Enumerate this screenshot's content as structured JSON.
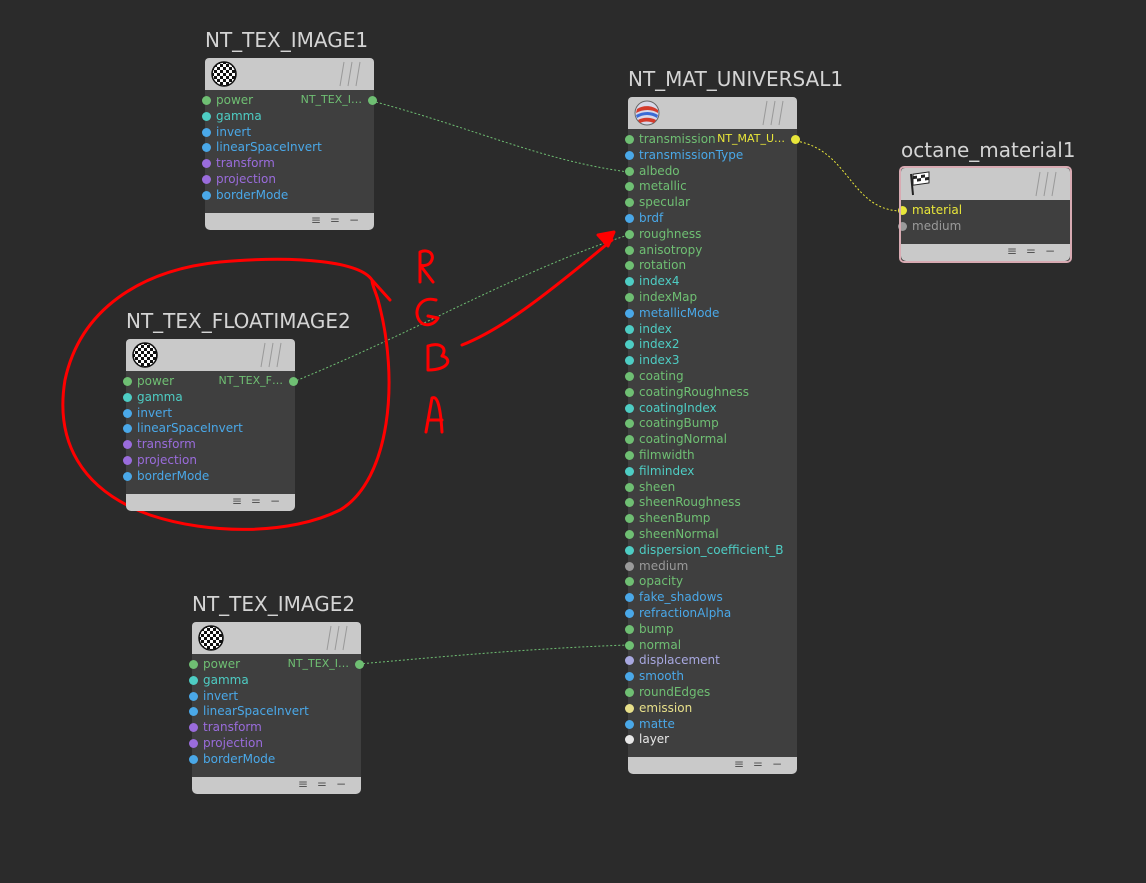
{
  "colors": {
    "background": "#2b2b2b",
    "green": "#6fbf73",
    "cyan": "#4ecdc4",
    "blue": "#4aa8e8",
    "purple": "#9a6cdc",
    "yellow": "#e8e63a",
    "gray": "#9a9a9a",
    "white": "#e8e8e8",
    "lavender": "#a8a8e0",
    "paleyellow": "#e8e08a",
    "annotation_red": "#ff0000"
  },
  "nodes": {
    "tex_image1": {
      "title": "NT_TEX_IMAGE1",
      "icon": "checker-sphere-icon",
      "output_label": "NT_TEX_I…",
      "inputs": [
        {
          "label": "power",
          "color": "green"
        },
        {
          "label": "gamma",
          "color": "cyan"
        },
        {
          "label": "invert",
          "color": "blue"
        },
        {
          "label": "linearSpaceInvert",
          "color": "blue"
        },
        {
          "label": "transform",
          "color": "purple"
        },
        {
          "label": "projection",
          "color": "purple"
        },
        {
          "label": "borderMode",
          "color": "blue"
        }
      ]
    },
    "tex_floatimage2": {
      "title": "NT_TEX_FLOATIMAGE2",
      "icon": "checker-sphere-icon",
      "output_label": "NT_TEX_F…",
      "inputs": [
        {
          "label": "power",
          "color": "green"
        },
        {
          "label": "gamma",
          "color": "cyan"
        },
        {
          "label": "invert",
          "color": "blue"
        },
        {
          "label": "linearSpaceInvert",
          "color": "blue"
        },
        {
          "label": "transform",
          "color": "purple"
        },
        {
          "label": "projection",
          "color": "purple"
        },
        {
          "label": "borderMode",
          "color": "blue"
        }
      ]
    },
    "tex_image2": {
      "title": "NT_TEX_IMAGE2",
      "icon": "checker-sphere-icon",
      "output_label": "NT_TEX_I…",
      "inputs": [
        {
          "label": "power",
          "color": "green"
        },
        {
          "label": "gamma",
          "color": "cyan"
        },
        {
          "label": "invert",
          "color": "blue"
        },
        {
          "label": "linearSpaceInvert",
          "color": "blue"
        },
        {
          "label": "transform",
          "color": "purple"
        },
        {
          "label": "projection",
          "color": "purple"
        },
        {
          "label": "borderMode",
          "color": "blue"
        }
      ]
    },
    "mat_universal1": {
      "title": "NT_MAT_UNIVERSAL1",
      "icon": "material-sphere-icon",
      "output_label": "NT_MAT_U…",
      "inputs": [
        {
          "label": "transmission",
          "color": "green"
        },
        {
          "label": "transmissionType",
          "color": "blue"
        },
        {
          "label": "albedo",
          "color": "green"
        },
        {
          "label": "metallic",
          "color": "green"
        },
        {
          "label": "specular",
          "color": "green"
        },
        {
          "label": "brdf",
          "color": "blue"
        },
        {
          "label": "roughness",
          "color": "green"
        },
        {
          "label": "anisotropy",
          "color": "green"
        },
        {
          "label": "rotation",
          "color": "green"
        },
        {
          "label": "index4",
          "color": "cyan"
        },
        {
          "label": "indexMap",
          "color": "green"
        },
        {
          "label": "metallicMode",
          "color": "blue"
        },
        {
          "label": "index",
          "color": "cyan"
        },
        {
          "label": "index2",
          "color": "cyan"
        },
        {
          "label": "index3",
          "color": "cyan"
        },
        {
          "label": "coating",
          "color": "green"
        },
        {
          "label": "coatingRoughness",
          "color": "green"
        },
        {
          "label": "coatingIndex",
          "color": "cyan"
        },
        {
          "label": "coatingBump",
          "color": "green"
        },
        {
          "label": "coatingNormal",
          "color": "green"
        },
        {
          "label": "filmwidth",
          "color": "green"
        },
        {
          "label": "filmindex",
          "color": "cyan"
        },
        {
          "label": "sheen",
          "color": "green"
        },
        {
          "label": "sheenRoughness",
          "color": "green"
        },
        {
          "label": "sheenBump",
          "color": "green"
        },
        {
          "label": "sheenNormal",
          "color": "green"
        },
        {
          "label": "dispersion_coefficient_B",
          "color": "cyan"
        },
        {
          "label": "medium",
          "color": "gray"
        },
        {
          "label": "opacity",
          "color": "green"
        },
        {
          "label": "fake_shadows",
          "color": "blue"
        },
        {
          "label": "refractionAlpha",
          "color": "blue"
        },
        {
          "label": "bump",
          "color": "green"
        },
        {
          "label": "normal",
          "color": "green"
        },
        {
          "label": "displacement",
          "color": "lavender"
        },
        {
          "label": "smooth",
          "color": "blue"
        },
        {
          "label": "roundEdges",
          "color": "green"
        },
        {
          "label": "emission",
          "color": "paleyellow"
        },
        {
          "label": "matte",
          "color": "blue"
        },
        {
          "label": "layer",
          "color": "white"
        }
      ]
    },
    "octane_material1": {
      "title": "octane_material1",
      "icon": "checkered-flag-icon",
      "inputs": [
        {
          "label": "material",
          "color": "yellow"
        },
        {
          "label": "medium",
          "color": "gray"
        }
      ]
    }
  },
  "footer_buttons": [
    "≡",
    "=",
    "−"
  ],
  "annotation": {
    "letters": [
      "R",
      "G",
      "B",
      "A"
    ]
  }
}
